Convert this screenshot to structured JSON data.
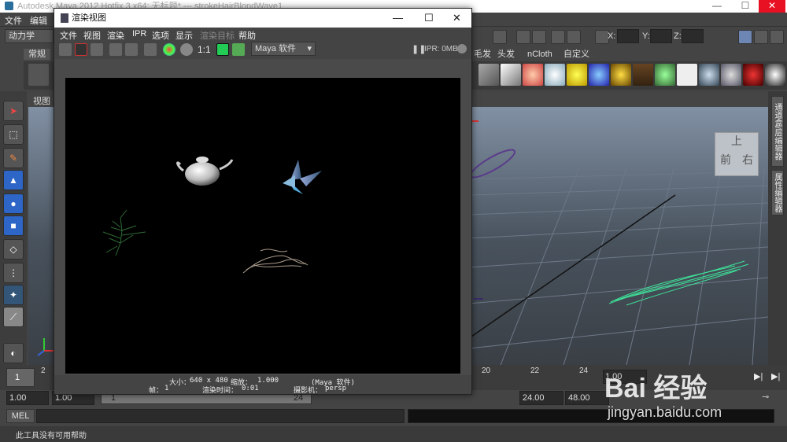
{
  "app": {
    "title": "Autodesk Maya 2012 Hotfix 3 x64: 无标题*   ---   strokeHairBlondWave1",
    "window_controls": {
      "minimize": "—",
      "maximize": "☐",
      "close": "✕"
    }
  },
  "main_menu": [
    "文件",
    "编辑"
  ],
  "mode_select": "动力学",
  "coords": {
    "x_label": "X:",
    "y_label": "Y:",
    "z_label": "Z:"
  },
  "shelf_tabs": [
    "常规",
    "毛发",
    "头发",
    "nCloth",
    "自定义"
  ],
  "viewport": {
    "menu": "视图"
  },
  "view_cube": {
    "top": "上",
    "front": "前",
    "right": "右"
  },
  "right_tabs": [
    "通道盒/层编辑器",
    "属性编辑器"
  ],
  "timeline": {
    "ticks": [
      "1",
      "2",
      "20",
      "22",
      "24"
    ],
    "current_frame": "1.00"
  },
  "range": {
    "start": "1.00",
    "playback_start": "1.00",
    "slider_start": "1",
    "slider_end": "24",
    "playback_end": "24.00",
    "end": "48.00"
  },
  "mel": {
    "label": "MEL"
  },
  "help_line": "此工具没有可用帮助",
  "render_view": {
    "title": "渲染视图",
    "menu": [
      "文件",
      "视图",
      "渲染",
      "IPR",
      "选项",
      "显示",
      "渲染目标",
      "帮助"
    ],
    "renderer": "Maya 软件",
    "ipr_status": "IPR: 0MB",
    "zoom_label": "1:1",
    "info": {
      "size_label": "大小：",
      "size": "640 x 480",
      "zoom_label": "缩放：",
      "zoom": "1.000",
      "renderer": "(Maya 软件)",
      "frame_label": "帧：",
      "frame": "1",
      "render_time_label": "渲染时间：",
      "render_time": "0:01",
      "camera_label": "摄影机：",
      "camera": "persp"
    }
  },
  "watermark": {
    "text": "Bai 经验",
    "url": "jingyan.baidu.com"
  },
  "colors": {
    "background": "#444444",
    "canvas": "#000000",
    "grid": "#6d7888",
    "hair_green": "#3ee39a",
    "accent": "#c8312d"
  }
}
